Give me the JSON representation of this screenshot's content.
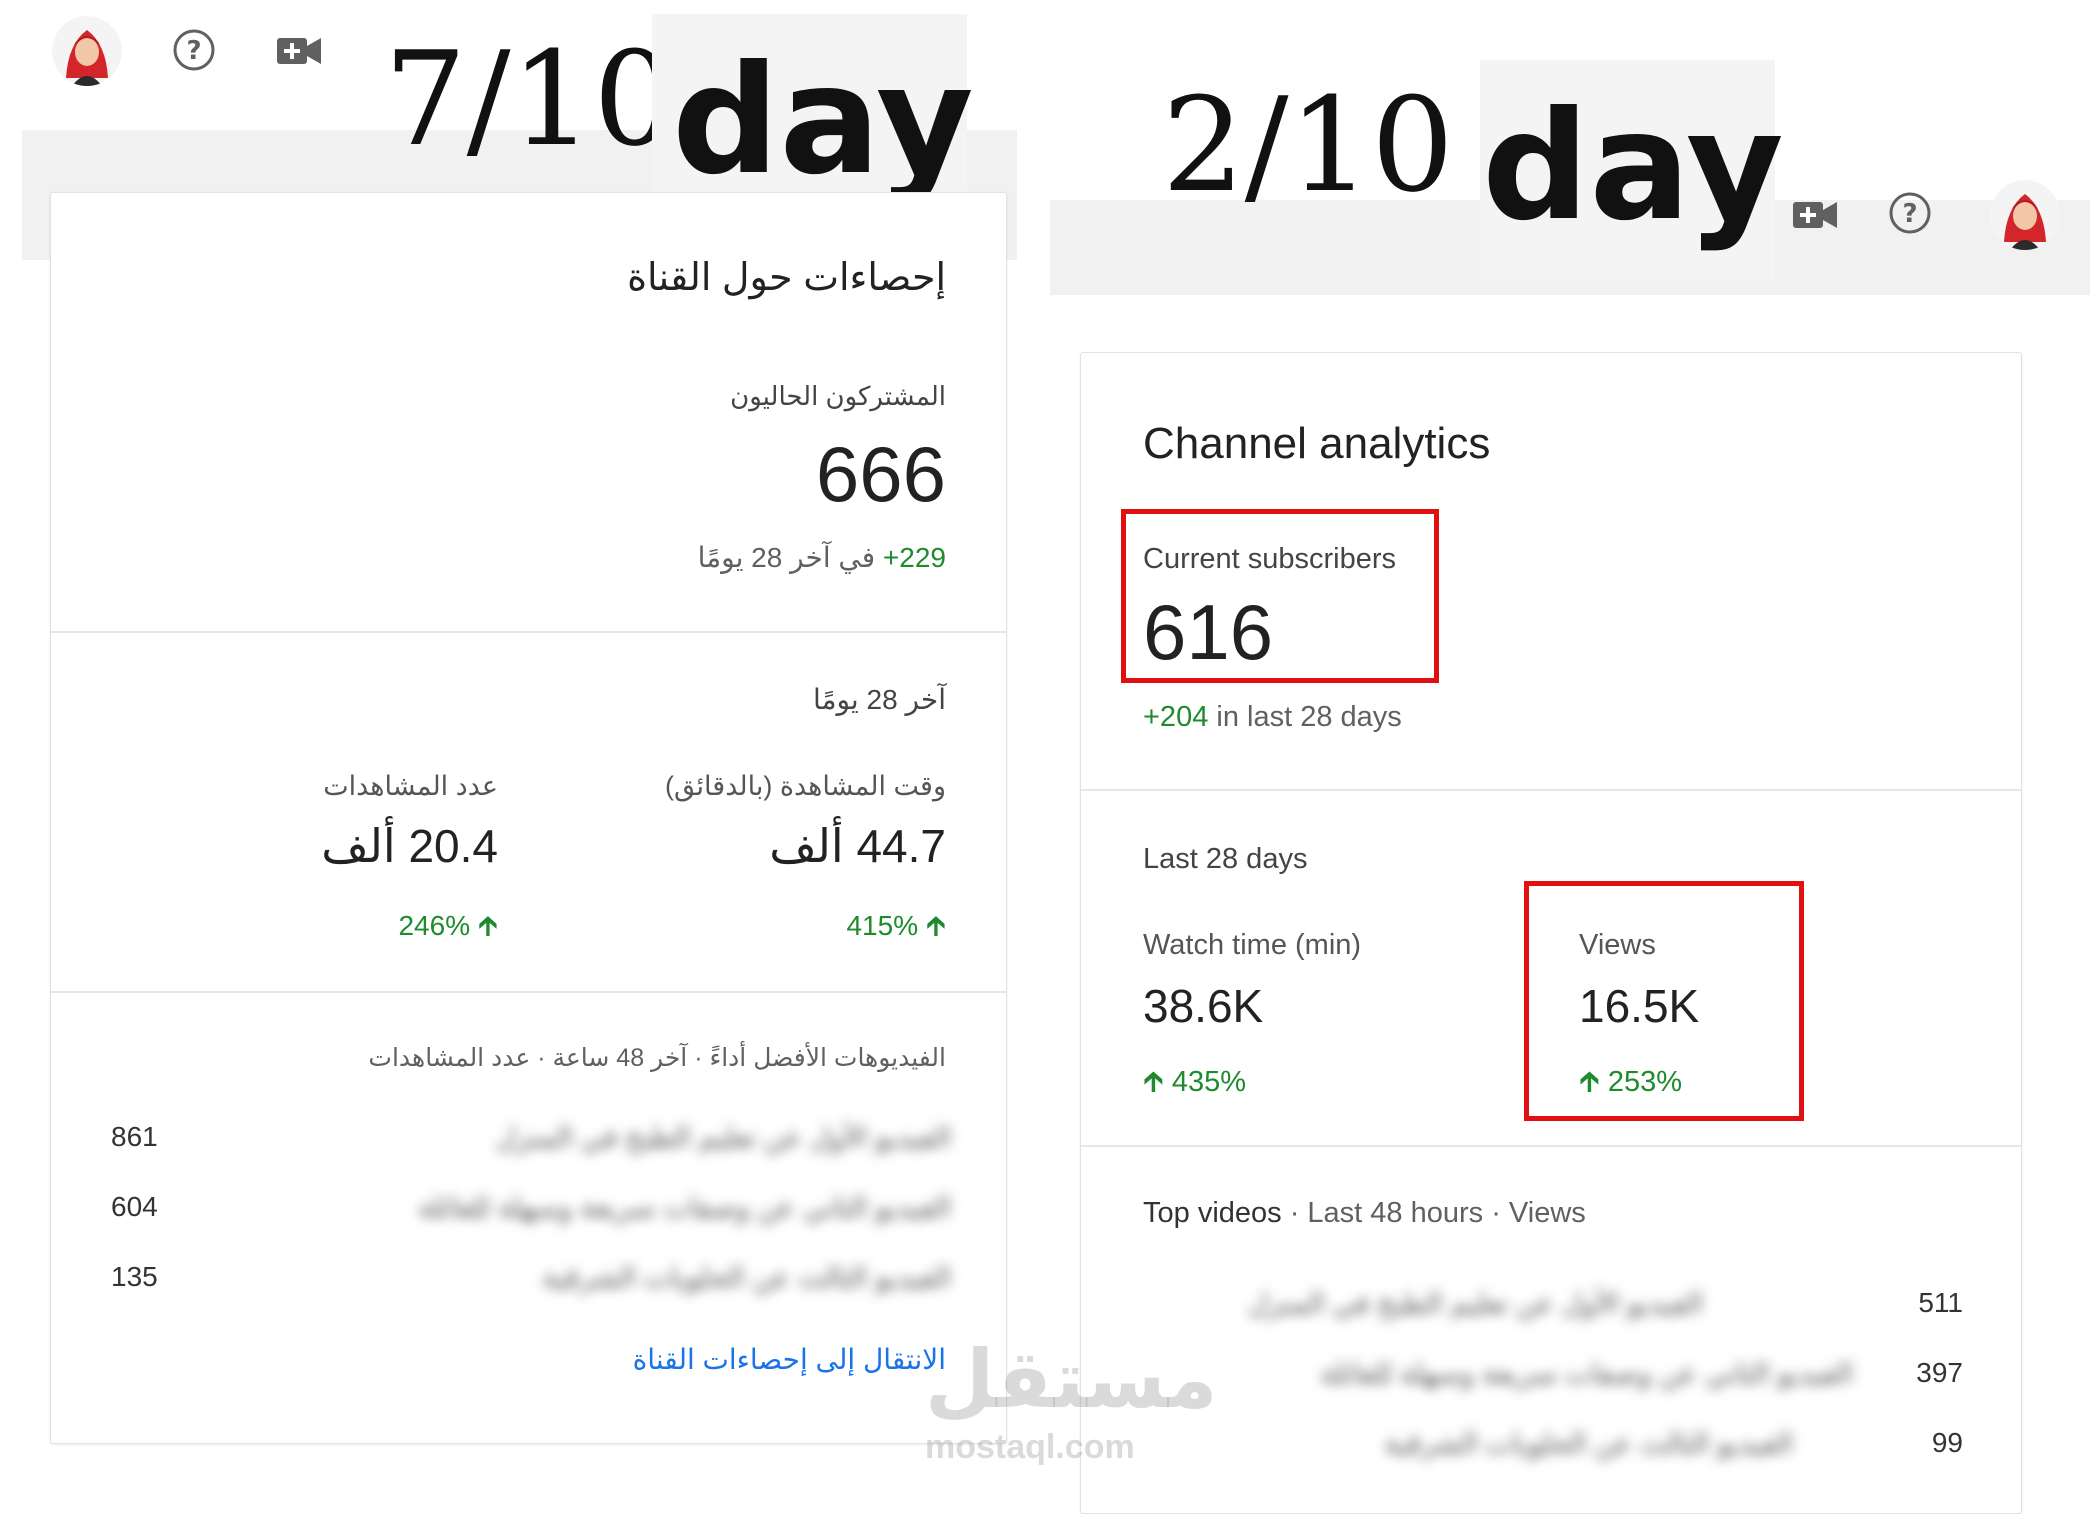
{
  "left": {
    "date": "7/10",
    "day": "day",
    "title": "إحصاءات حول القناة",
    "subscribers_label": "المشتركون الحاليون",
    "subscribers_value": "666",
    "subscribers_change": "+229",
    "subscribers_change_suffix": "في آخر 28 يومًا",
    "period_label": "آخر 28 يومًا",
    "watch_time_label": "وقت المشاهدة (بالدقائق)",
    "watch_time_value": "44.7 ألف",
    "watch_time_change": "415%",
    "views_label": "عدد المشاهدات",
    "views_value": "20.4 ألف",
    "views_change": "246%",
    "top_videos_header": "الفيديوهات الأفضل أداءً · آخر 48 ساعة · عدد المشاهدات",
    "top_videos": [
      {
        "title": "الفيديو الأول عن تعليم الطبخ في المنزل",
        "views": "861"
      },
      {
        "title": "الفيديو الثاني عن وصفات سريعة وسهلة للعائلة",
        "views": "604"
      },
      {
        "title": "الفيديو الثالث عن الحلويات الشرقية",
        "views": "135"
      }
    ],
    "link": "الانتقال إلى إحصاءات القناة"
  },
  "right": {
    "date": "2/10",
    "day": "day",
    "title": "Channel analytics",
    "subscribers_label": "Current subscribers",
    "subscribers_value": "616",
    "subscribers_change": "+204",
    "subscribers_change_suffix": "in last 28 days",
    "period_label": "Last 28 days",
    "watch_time_label": "Watch time (min)",
    "watch_time_value": "38.6K",
    "watch_time_change": "435%",
    "views_label": "Views",
    "views_value": "16.5K",
    "views_change": "253%",
    "top_videos_label": "Top videos",
    "top_videos_meta": " · Last 48 hours · Views",
    "top_videos": [
      {
        "title": "الفيديو الأول عن تعليم الطبخ في المنزل",
        "views": "511"
      },
      {
        "title": "الفيديو الثاني عن وصفات سريعة وسهلة للعائلة",
        "views": "397"
      },
      {
        "title": "الفيديو الثالث عن الحلويات الشرقية",
        "views": "99"
      }
    ]
  },
  "watermark": {
    "ar": "مستقل",
    "en": "mostaql.com"
  },
  "icons": [
    "avatar",
    "help-icon",
    "add-video-icon",
    "up-arrow-icon"
  ],
  "colors": {
    "accent_green": "#1f8a2e",
    "highlight_red": "#e01010",
    "link_blue": "#1a73e8"
  }
}
